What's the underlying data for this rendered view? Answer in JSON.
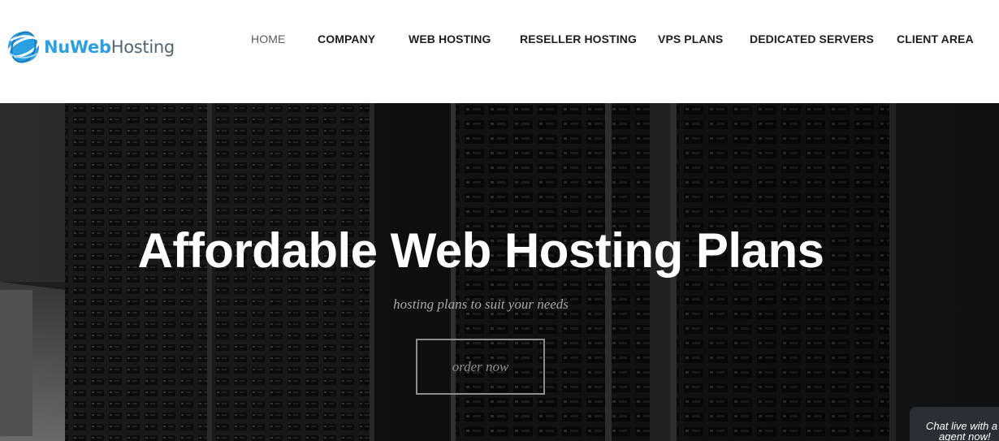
{
  "brand": {
    "name_part1": "NuWeb",
    "name_part2": "Hosting",
    "primary_color": "#2b9fe0",
    "secondary_color": "#4f6575",
    "logo_icon": "globe-swirl-icon"
  },
  "nav": {
    "items": [
      {
        "label": "HOME",
        "active": true
      },
      {
        "label": "COMPANY",
        "active": false
      },
      {
        "label": "WEB HOSTING",
        "active": false
      },
      {
        "label": "RESELLER HOSTING",
        "active": false
      },
      {
        "label": "VPS PLANS",
        "active": false
      },
      {
        "label": "DEDICATED SERVERS",
        "active": false
      },
      {
        "label": "CLIENT AREA",
        "active": false
      }
    ]
  },
  "hero": {
    "title": "Affordable Web Hosting Plans",
    "subtitle": "hosting plans to suit your needs",
    "cta_label": "order now",
    "background": "server-racks-photo"
  },
  "chat": {
    "line1": "Chat live with a",
    "line2": "agent now!"
  }
}
